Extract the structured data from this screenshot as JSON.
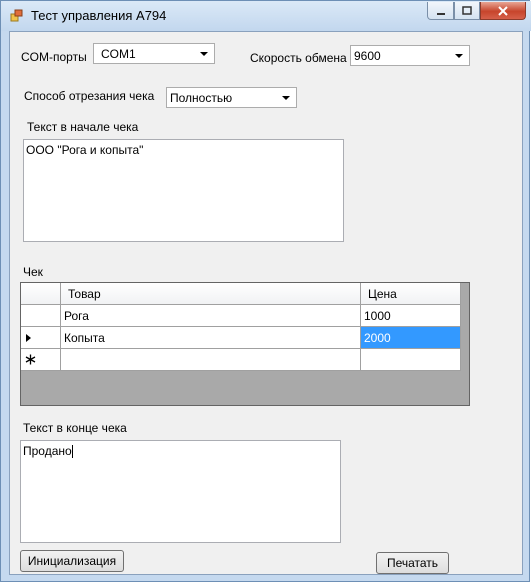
{
  "window": {
    "title": "Тест управления A794"
  },
  "settings": {
    "com_label": "COM-порты",
    "com_value": "COM1",
    "speed_label": "Скорость обмена",
    "speed_value": "9600",
    "cut_label": "Способ отрезания чека",
    "cut_value": "Полностью"
  },
  "header_text": {
    "label": "Текст в начале чека",
    "value": "ООО \"Рога и копыта\""
  },
  "receipt_grid": {
    "label": "Чек",
    "columns": [
      "Товар",
      "Цена"
    ],
    "rows": [
      {
        "item": "Рога",
        "price": "1000"
      },
      {
        "item": "Копыта",
        "price": "2000"
      }
    ]
  },
  "footer_text": {
    "label": "Текст в конце чека",
    "value": "Продано"
  },
  "buttons": {
    "init": "Инициализация",
    "print": "Печатать"
  },
  "colors": {
    "selection": "#3399ff",
    "window_frame": "#c5d9ef",
    "close_button": "#c7452c"
  }
}
